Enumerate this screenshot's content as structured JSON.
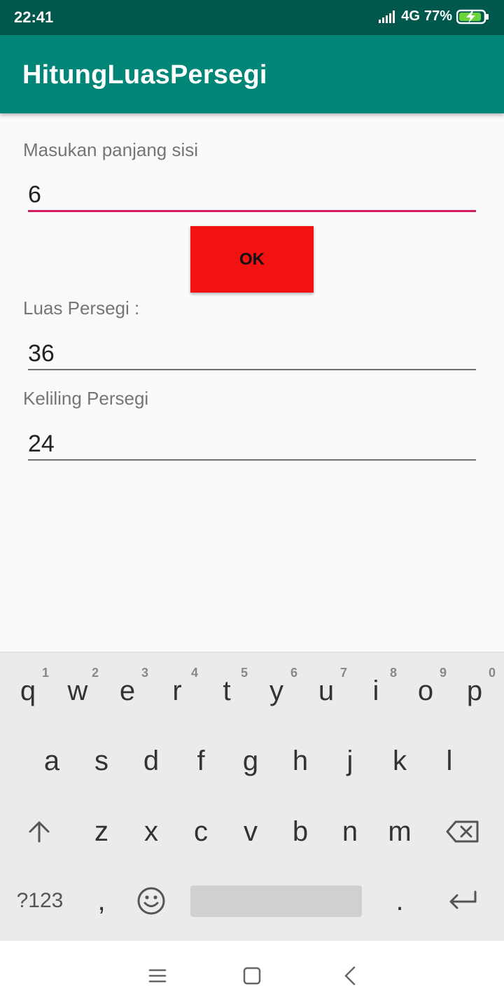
{
  "status": {
    "time": "22:41",
    "network": "4G",
    "battery": "77%"
  },
  "app": {
    "title": "HitungLuasPersegi"
  },
  "form": {
    "side_label": "Masukan panjang sisi",
    "side_value": "6",
    "ok_label": "OK",
    "area_label": "Luas Persegi :",
    "area_value": "36",
    "perimeter_label": "Keliling Persegi",
    "perimeter_value": "24",
    "active_underline_color": "#d81b60",
    "button_color": "#f21212",
    "appbar_color": "#008577"
  },
  "keyboard": {
    "row1": [
      {
        "k": "q",
        "h": "1"
      },
      {
        "k": "w",
        "h": "2"
      },
      {
        "k": "e",
        "h": "3"
      },
      {
        "k": "r",
        "h": "4"
      },
      {
        "k": "t",
        "h": "5"
      },
      {
        "k": "y",
        "h": "6"
      },
      {
        "k": "u",
        "h": "7"
      },
      {
        "k": "i",
        "h": "8"
      },
      {
        "k": "o",
        "h": "9"
      },
      {
        "k": "p",
        "h": "0"
      }
    ],
    "row2": [
      "a",
      "s",
      "d",
      "f",
      "g",
      "h",
      "j",
      "k",
      "l"
    ],
    "row3": [
      "z",
      "x",
      "c",
      "v",
      "b",
      "n",
      "m"
    ],
    "symbols_label": "?123",
    "comma": ",",
    "period": "."
  }
}
